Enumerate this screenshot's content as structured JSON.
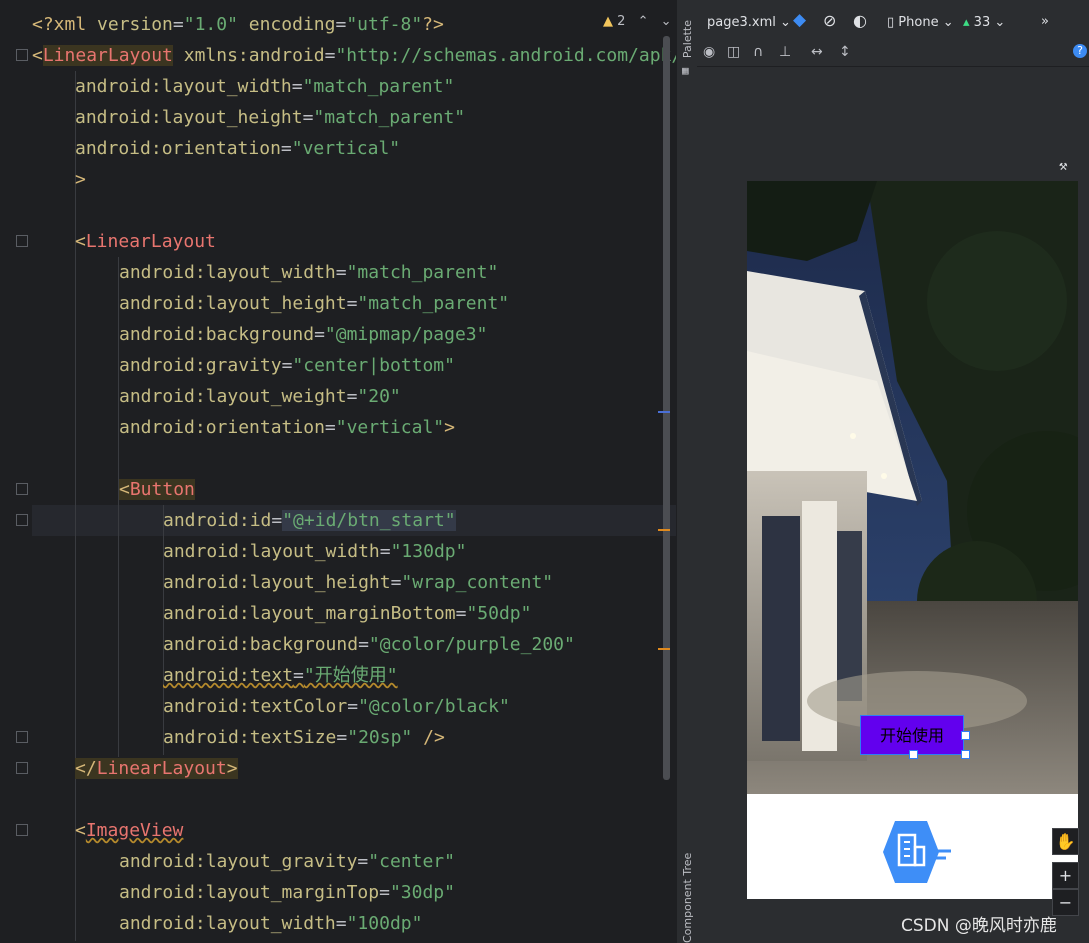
{
  "editor": {
    "warnings_count": "2",
    "code": {
      "l1": {
        "a": "<?xml ",
        "b": "version",
        "c": "=",
        "d": "\"1.0\"",
        "e": " encoding",
        "f": "=",
        "g": "\"utf-8\"",
        "h": "?>"
      },
      "l2": {
        "open": "<",
        "name": "LinearLayout",
        "attr": " xmlns:android",
        "eq": "=",
        "val": "\"http://schemas.android.com/apk/res/android\""
      },
      "l3": {
        "attr": "android:layout_width",
        "eq": "=",
        "val": "\"match_parent\""
      },
      "l4": {
        "attr": "android:layout_height",
        "eq": "=",
        "val": "\"match_parent\""
      },
      "l5": {
        "attr": "android:orientation",
        "eq": "=",
        "val": "\"vertical\""
      },
      "l6": {
        "close": ">"
      },
      "l7": {
        "open": "<",
        "name": "LinearLayout"
      },
      "l8": {
        "attr": "android:layout_width",
        "eq": "=",
        "val": "\"match_parent\""
      },
      "l9": {
        "attr": "android:layout_height",
        "eq": "=",
        "val": "\"match_parent\""
      },
      "l10": {
        "attr": "android:background",
        "eq": "=",
        "val": "\"@mipmap/page3\""
      },
      "l11": {
        "attr": "android:gravity",
        "eq": "=",
        "val": "\"center|bottom\""
      },
      "l12": {
        "attr": "android:layout_weight",
        "eq": "=",
        "val": "\"20\""
      },
      "l13": {
        "attr": "android:orientation",
        "eq": "=",
        "val": "\"vertical\"",
        "close": ">"
      },
      "l14": {
        "open": "<",
        "name": "Button"
      },
      "l15": {
        "attr": "android:id",
        "eq": "=",
        "val": "\"@+id/btn_start\""
      },
      "l16": {
        "attr": "android:layout_width",
        "eq": "=",
        "val": "\"130dp\""
      },
      "l17": {
        "attr": "android:layout_height",
        "eq": "=",
        "val": "\"wrap_content\""
      },
      "l18": {
        "attr": "android:layout_marginBottom",
        "eq": "=",
        "val": "\"50dp\""
      },
      "l19": {
        "attr": "android:background",
        "eq": "=",
        "val": "\"@color/purple_200\""
      },
      "l20": {
        "attr": "android:text",
        "eq": "=",
        "val": "\"开始使用\""
      },
      "l21": {
        "attr": "android:textColor",
        "eq": "=",
        "val": "\"@color/black\""
      },
      "l22": {
        "attr": "android:textSize",
        "eq": "=",
        "val": "\"20sp\"",
        "close": " />"
      },
      "l23": {
        "open": "</",
        "name": "LinearLayout",
        "close": ">"
      },
      "l24": {
        "open": "<",
        "name": "ImageView"
      },
      "l25": {
        "attr": "android:layout_gravity",
        "eq": "=",
        "val": "\"center\""
      },
      "l26": {
        "attr": "android:layout_marginTop",
        "eq": "=",
        "val": "\"30dp\""
      },
      "l27": {
        "attr": "android:layout_width",
        "eq": "=",
        "val": "\"100dp\""
      }
    }
  },
  "sidebar": {
    "palette": "Palette",
    "component_tree": "Component Tree"
  },
  "design": {
    "file_dropdown": "page3.xml",
    "device_dropdown": "Phone",
    "api_dropdown": "33",
    "preview_button_text": "开始使用"
  },
  "watermark": "CSDN @晚风时亦鹿",
  "colors": {
    "accent": "#2e7df7",
    "button_bg": "#6200ee",
    "tag": "#d5b778",
    "string": "#6aab73",
    "attribute": "#c6bd85"
  }
}
